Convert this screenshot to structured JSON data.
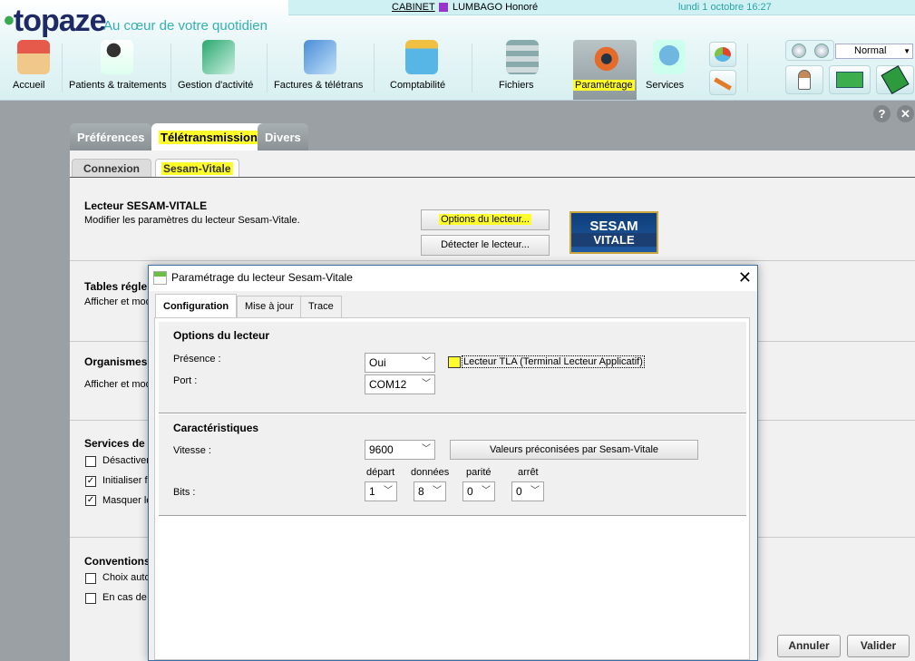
{
  "app": {
    "logo_text": "topaze",
    "tagline": "Au cœur de votre quotidien"
  },
  "topbar": {
    "cabinet": "CABINET",
    "patient": "LUMBAGO Honoré",
    "datetime": "lundi 1 octobre 16:27",
    "patient_color": "#9a35c9"
  },
  "nav": [
    {
      "label": "Accueil",
      "icon": "house-icon"
    },
    {
      "label": "Patients & traitements",
      "icon": "patients-icon"
    },
    {
      "label": "Gestion d'activité",
      "icon": "documents-icon"
    },
    {
      "label": "Factures & télétrans",
      "icon": "invoices-icon"
    },
    {
      "label": "Comptabilité",
      "icon": "calculator-icon"
    },
    {
      "label": "Fichiers",
      "icon": "database-icon"
    },
    {
      "label": "Paramétrage",
      "icon": "gears-icon"
    },
    {
      "label": "Services",
      "icon": "globe-icon"
    }
  ],
  "display_mode": "Normal",
  "main_tabs": [
    "Préférences",
    "Télétransmission",
    "Divers"
  ],
  "sub_tabs": [
    "Connexion",
    "Sesam-Vitale"
  ],
  "lecteur_section": {
    "title": "Lecteur SESAM-VITALE",
    "desc": "Modifier les paramètres du lecteur Sesam-Vitale.",
    "options_button": "Options du lecteur...",
    "detect_button": "Détecter le lecteur...",
    "logo_line1": "SESAM",
    "logo_line2": "VITALE"
  },
  "tables_section": {
    "title": "Tables réglementaires",
    "desc": "Afficher et modifier"
  },
  "organismes_section": {
    "title": "Organismes",
    "desc": "Afficher et modifier"
  },
  "services_section": {
    "title": "Services de Télétransmission",
    "items": [
      {
        "label": "Désactiver",
        "checked": false
      },
      {
        "label": "Initialiser fe",
        "checked": true
      },
      {
        "label": "Masquer le",
        "checked": true
      }
    ]
  },
  "conventions_section": {
    "title": "Conventions",
    "items": [
      {
        "label": "Choix auto",
        "checked": false
      },
      {
        "label": "En cas de",
        "checked": false
      }
    ]
  },
  "footer": {
    "cancel": "Annuler",
    "validate": "Valider"
  },
  "dialog": {
    "title": "Paramétrage du lecteur Sesam-Vitale",
    "tabs": [
      "Configuration",
      "Mise à jour",
      "Trace"
    ],
    "options_group": {
      "title": "Options du lecteur",
      "presence_label": "Présence :",
      "presence_value": "Oui",
      "tla_label": "Lecteur TLA (Terminal Lecteur Applicatif)",
      "port_label": "Port :",
      "port_value": "COM12"
    },
    "caract_group": {
      "title": "Caractéristiques",
      "vitesse_label": "Vitesse :",
      "vitesse_value": "9600",
      "preset_button": "Valeurs préconisées par Sesam-Vitale",
      "bits_label": "Bits :",
      "bits_headers": [
        "départ",
        "données",
        "parité",
        "arrêt"
      ],
      "bits_values": [
        "1",
        "8",
        "0",
        "0"
      ]
    }
  }
}
